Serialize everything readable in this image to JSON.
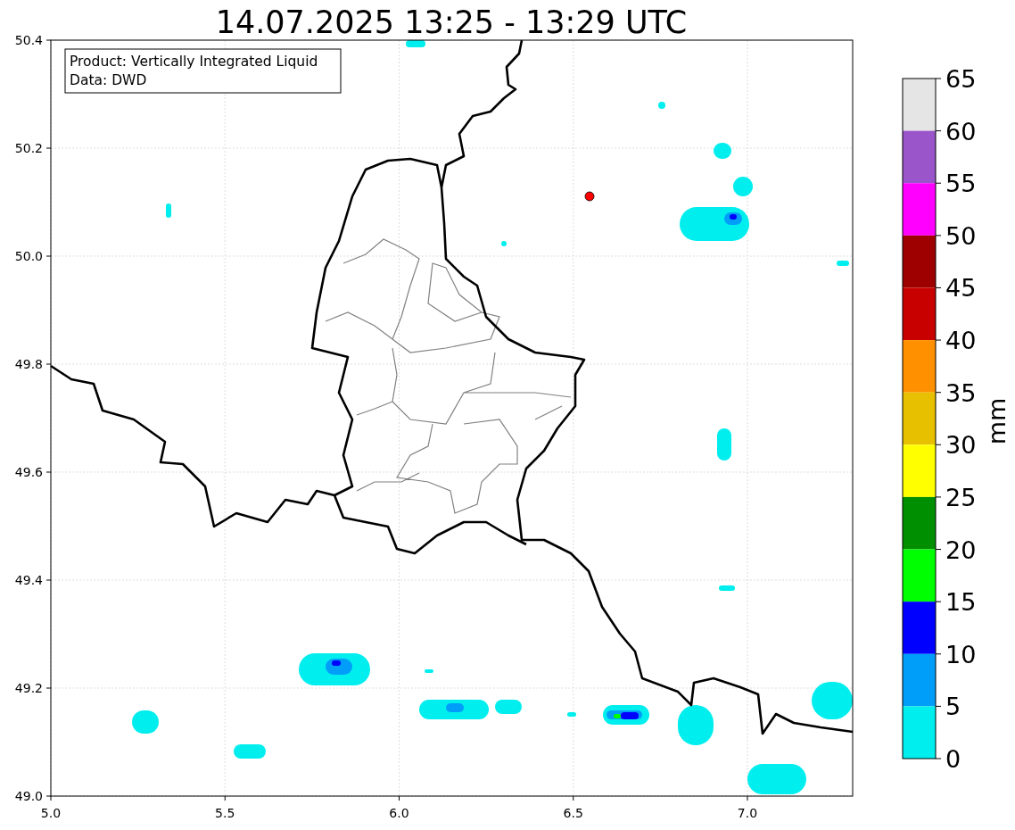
{
  "title": "14.07.2025 13:25 - 13:29 UTC",
  "info_box": [
    "Product: Vertically Integrated Liquid",
    "Data: DWD"
  ],
  "x_ticks": [
    "5.0",
    "5.5",
    "6.0",
    "6.5",
    "7.0"
  ],
  "y_ticks": [
    "50.4",
    "50.2",
    "50.0",
    "49.8",
    "49.6",
    "49.4",
    "49.2",
    "49.0"
  ],
  "colorbar": {
    "label": "mm",
    "bands": [
      {
        "color": "#e5e5e5"
      },
      {
        "color": "#9955c9"
      },
      {
        "color": "#ff00ff"
      },
      {
        "color": "#9e0000"
      },
      {
        "color": "#c80000"
      },
      {
        "color": "#ff9000"
      },
      {
        "color": "#e7c000"
      },
      {
        "color": "#ffff00"
      },
      {
        "color": "#008f00"
      },
      {
        "color": "#00ff00"
      },
      {
        "color": "#0000ff"
      },
      {
        "color": "#009ef9"
      },
      {
        "color": "#00eeee"
      }
    ],
    "ticks": [
      "65",
      "60",
      "55",
      "50",
      "45",
      "40",
      "35",
      "30",
      "25",
      "20",
      "15",
      "10",
      "5",
      "0"
    ]
  }
}
